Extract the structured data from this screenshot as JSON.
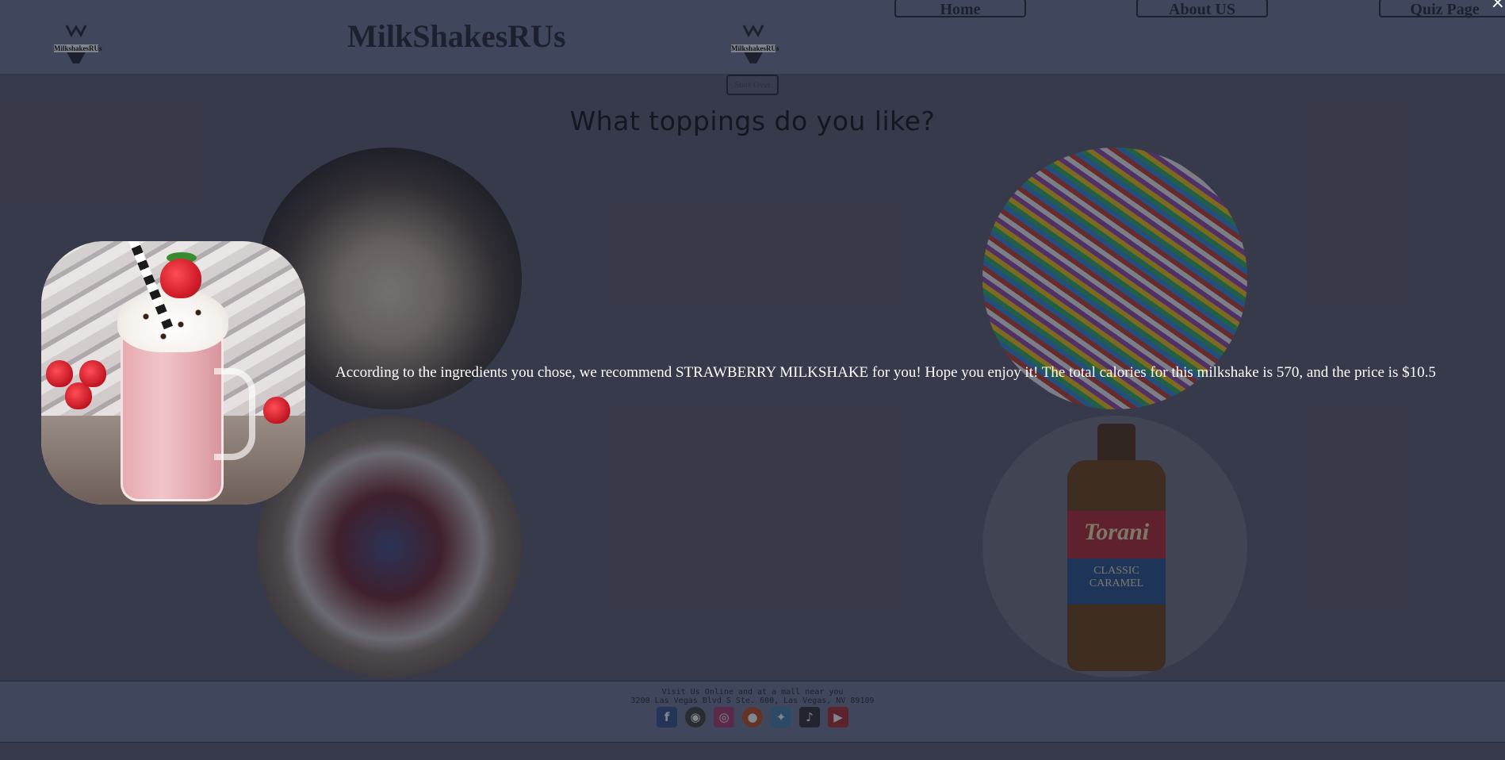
{
  "header": {
    "site_title": "MilkShakesRUs",
    "logo_text": "MilkshakesRUs",
    "nav": {
      "home": "Home",
      "about": "About US",
      "quiz": "Quiz Page"
    },
    "close_label": "×"
  },
  "quiz": {
    "start_over_label": "Start Over",
    "question": "What toppings do you like?",
    "toppings": {
      "caramel_brand": "Torani",
      "caramel_flavor_1": "CLASSIC",
      "caramel_flavor_2": "CARAMEL"
    }
  },
  "result": {
    "message": "According to the ingredients you chose, we recommend STRAWBERRY MILKSHAKE for you! Hope you enjoy it! The total calories for this milkshake is 570, and the price is $10.5"
  },
  "footer": {
    "line1": "Visit Us Online and at a mall near you",
    "line2": "3200 Las Vegas Blvd S Ste. 600, Las Vegas, NV 89109",
    "socials": {
      "facebook": "f",
      "github": "◉",
      "instagram": "◎",
      "reddit": "●",
      "twitter": "✦",
      "tiktok": "♪",
      "youtube": "▶"
    }
  },
  "colors": {
    "header_bg": "#6b7596",
    "page_bg": "#575a6e",
    "result_text": "#ffffff"
  }
}
